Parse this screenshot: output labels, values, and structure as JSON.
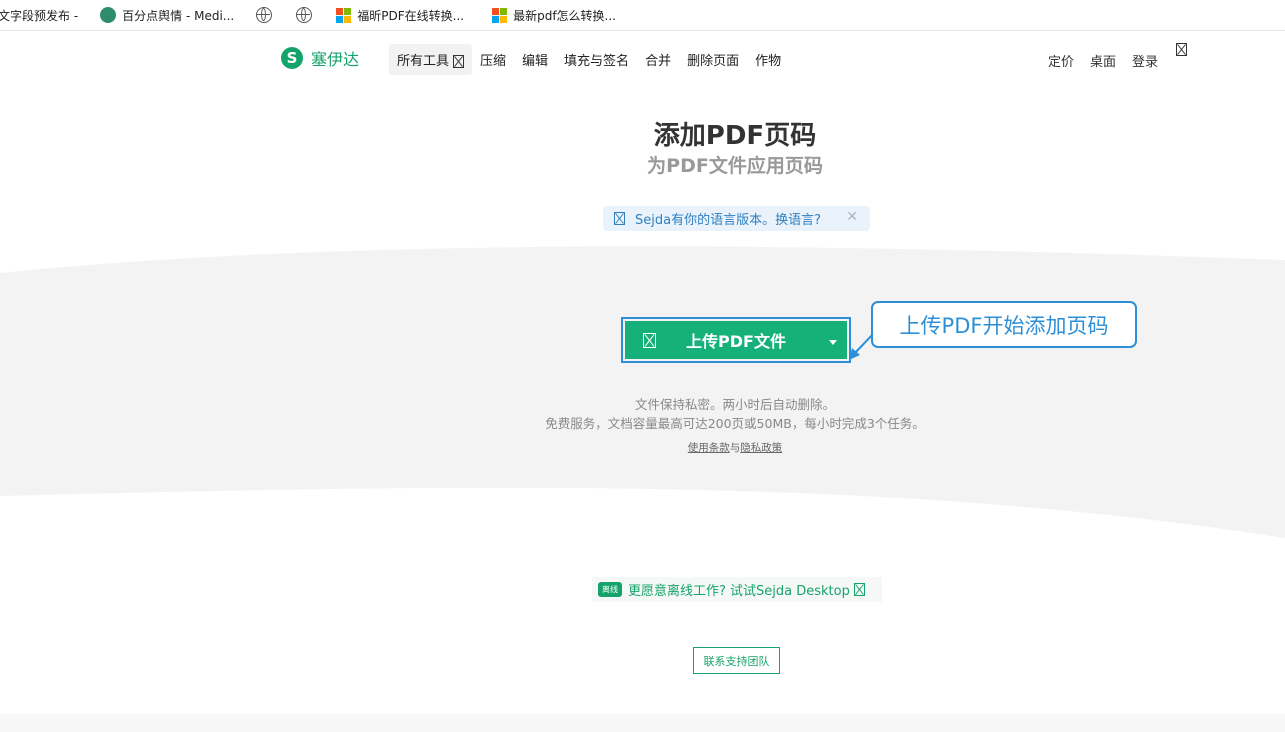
{
  "bookmarks": [
    {
      "label": "文字段预发布 -",
      "icon": "none"
    },
    {
      "label": "百分点舆情 - Medi...",
      "icon": "app-icon"
    },
    {
      "label": "",
      "icon": "globe-icon"
    },
    {
      "label": "",
      "icon": "globe-icon"
    },
    {
      "label": "福昕PDF在线转换...",
      "icon": "windows-icon"
    },
    {
      "label": "最新pdf怎么转换...",
      "icon": "windows-icon"
    }
  ],
  "brand": {
    "logo_letter": "S",
    "name": "塞伊达"
  },
  "nav": {
    "items": [
      "所有工具",
      "压缩",
      "编辑",
      "填充与签名",
      "合并",
      "删除页面",
      "作物"
    ],
    "right": [
      "定价",
      "桌面",
      "登录"
    ]
  },
  "main": {
    "title": "添加PDF页码",
    "subtitle": "为PDF文件应用页码",
    "lang_notice": "Sejda有你的语言版本。换语言?",
    "lang_close": "✕",
    "upload_label": "上传PDF文件",
    "callout": "上传PDF开始添加页码",
    "info_line1": "文件保持私密。两小时后自动删除。",
    "info_line2": "免费服务，文档容量最高可达200页或50MB，每小时完成3个任务。",
    "terms_link": "使用条款",
    "links_and": "与",
    "privacy_link": "隐私政策",
    "desktop_badge": "离线",
    "desktop_text": "更愿意离线工作? 试试Sejda Desktop",
    "support_label": "联系支持团队"
  },
  "colors": {
    "brand_green": "#16a36b",
    "button_green": "#16b07a",
    "callout_blue": "#2f8fd6"
  }
}
